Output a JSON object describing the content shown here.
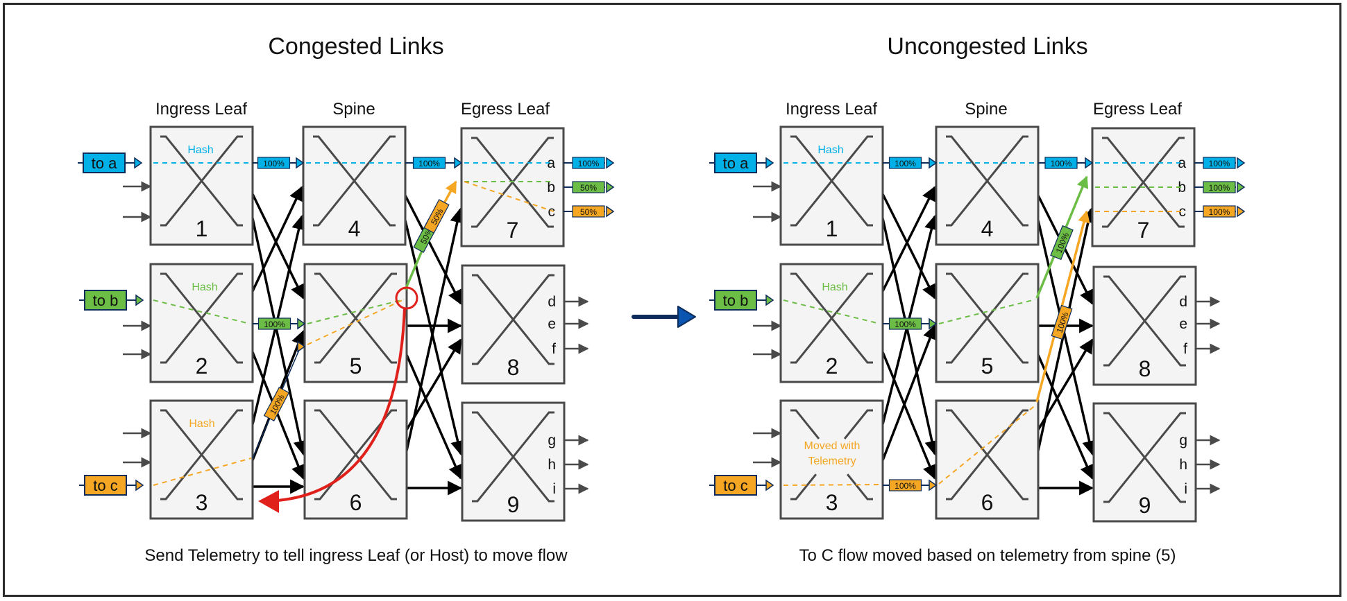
{
  "colors": {
    "flow_a": "#00b0e6",
    "flow_b": "#6cbd45",
    "flow_c": "#f5a623",
    "telemetry": "#e0201a",
    "link": "#000000",
    "box_border": "#4a4a4a",
    "box_fill": "#f4f4f4",
    "transition_arrow": "#0b54b0",
    "tag_border": "#0e2c5a"
  },
  "panels": [
    {
      "id": "congested",
      "title": "Congested Links",
      "caption": "Send Telemetry to tell ingress Leaf (or Host) to move flow",
      "columns": [
        "Ingress Leaf",
        "Spine",
        "Egress Leaf"
      ],
      "switches": [
        "1",
        "2",
        "3",
        "4",
        "5",
        "6",
        "7",
        "8",
        "9"
      ],
      "ingress_tags": [
        {
          "label": "to a",
          "flow": "a"
        },
        {
          "label": "to b",
          "flow": "b"
        },
        {
          "label": "to c",
          "flow": "c"
        }
      ],
      "hash_labels": [
        {
          "switch": "1",
          "text": "Hash",
          "flow": "a"
        },
        {
          "switch": "2",
          "text": "Hash",
          "flow": "b"
        },
        {
          "switch": "3",
          "text": "Hash",
          "flow": "c"
        }
      ],
      "ports": {
        "7": [
          "a",
          "b",
          "c"
        ],
        "8": [
          "d",
          "e",
          "f"
        ],
        "9": [
          "g",
          "h",
          "i"
        ]
      },
      "link_labels": [
        {
          "link": "1-4",
          "flow": "a",
          "value": "100%"
        },
        {
          "link": "4-7",
          "flow": "a",
          "value": "100%"
        },
        {
          "link": "2-5",
          "flow": "b",
          "value": "100%"
        },
        {
          "link": "3-5",
          "flow": "c",
          "value": "100%"
        },
        {
          "link": "5-7 (b)",
          "flow": "b",
          "value": "50%"
        },
        {
          "link": "5-7 (c)",
          "flow": "c",
          "value": "50%"
        }
      ],
      "egress_outputs": [
        {
          "port": "a",
          "flow": "a",
          "value": "100%"
        },
        {
          "port": "b",
          "flow": "b",
          "value": "50%"
        },
        {
          "port": "c",
          "flow": "c",
          "value": "50%"
        }
      ],
      "congestion_marker": "spine 5 uplink to 7",
      "telemetry_path": "spine 5 -> ingress leaf 3"
    },
    {
      "id": "uncongested",
      "title": "Uncongested Links",
      "caption": "To C flow moved based on telemetry from spine (5)",
      "columns": [
        "Ingress Leaf",
        "Spine",
        "Egress Leaf"
      ],
      "switches": [
        "1",
        "2",
        "3",
        "4",
        "5",
        "6",
        "7",
        "8",
        "9"
      ],
      "ingress_tags": [
        {
          "label": "to a",
          "flow": "a"
        },
        {
          "label": "to b",
          "flow": "b"
        },
        {
          "label": "to c",
          "flow": "c"
        }
      ],
      "hash_labels": [
        {
          "switch": "1",
          "text": "Hash",
          "flow": "a"
        },
        {
          "switch": "2",
          "text": "Hash",
          "flow": "b"
        }
      ],
      "moved_label": [
        "Moved with",
        "Telemetry"
      ],
      "ports": {
        "7": [
          "a",
          "b",
          "c"
        ],
        "8": [
          "d",
          "e",
          "f"
        ],
        "9": [
          "g",
          "h",
          "i"
        ]
      },
      "link_labels": [
        {
          "link": "1-4",
          "flow": "a",
          "value": "100%"
        },
        {
          "link": "4-7",
          "flow": "a",
          "value": "100%"
        },
        {
          "link": "2-5",
          "flow": "b",
          "value": "100%"
        },
        {
          "link": "3-6",
          "flow": "c",
          "value": "100%"
        },
        {
          "link": "5-7",
          "flow": "b",
          "value": "100%"
        },
        {
          "link": "6-7",
          "flow": "c",
          "value": "100%"
        }
      ],
      "egress_outputs": [
        {
          "port": "a",
          "flow": "a",
          "value": "100%"
        },
        {
          "port": "b",
          "flow": "b",
          "value": "100%"
        },
        {
          "port": "c",
          "flow": "c",
          "value": "100%"
        }
      ]
    }
  ]
}
